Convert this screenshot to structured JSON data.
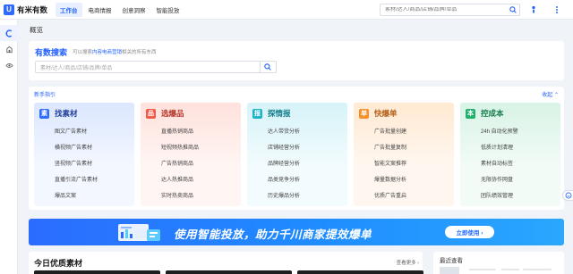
{
  "header": {
    "logo_mark": "U",
    "logo_text": "有米有数",
    "nav": [
      "工作台",
      "电商情报",
      "创意洞察",
      "智能投放"
    ],
    "search_placeholder": "素材/达人/商品/店铺/品牌/单品"
  },
  "rail": {
    "items": [
      "overview-icon",
      "shop-icon",
      "eye-icon"
    ]
  },
  "page_title": "概览",
  "search_card": {
    "title": "有数搜索",
    "sub_pre": "可以搜索",
    "sub_highlight": "内容电商营销",
    "sub_post": "相关的所有东西",
    "placeholder": "素材/达人/商品/店铺/品牌/单品"
  },
  "guide": {
    "title": "新手指引",
    "collapse": "收起 ⌃",
    "cards": [
      {
        "icon": "素",
        "title": "找素材",
        "items": [
          "图文广告素材",
          "横视频广告素材",
          "竖视频广告素材",
          "直播引流广告素材",
          "爆品文案"
        ]
      },
      {
        "icon": "品",
        "title": "选爆品",
        "items": [
          "直播热销商品",
          "短视频热推商品",
          "广告热销商品",
          "达人热推商品",
          "实时热卖商品"
        ]
      },
      {
        "icon": "报",
        "title": "探情报",
        "items": [
          "达人带货分析",
          "店铺经营分析",
          "品牌经营分析",
          "品类竞争分析",
          "历史爆品分析"
        ]
      },
      {
        "icon": "单",
        "title": "快爆单",
        "items": [
          "广告批量创建",
          "广告批量复制",
          "智能文案推荐",
          "爆量数据分析",
          "优质广告重启"
        ]
      },
      {
        "icon": "本",
        "title": "控成本",
        "items": [
          "24h 自动化预警",
          "低质计划清理",
          "素材自动标签",
          "无限协作网盘",
          "团队绩效管理"
        ]
      }
    ]
  },
  "banner": {
    "text": "使用智能投放，助力千川商家提效爆单",
    "button": "立即使用 ›"
  },
  "quality": {
    "title": "今日优质素材",
    "more": "查看更多 ›"
  },
  "recent": {
    "title": "最近查看"
  },
  "colors": {
    "brand": "#1f5eff",
    "banner": "#2b6cff"
  }
}
